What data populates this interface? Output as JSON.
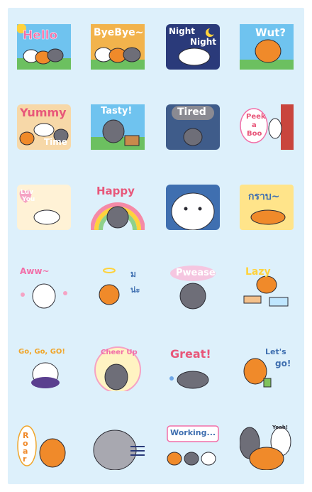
{
  "colors": {
    "panel": "#ddf0fb",
    "orange": "#f08a2a",
    "grey": "#6e6e78",
    "white": "#ffffff",
    "outline": "#2b2b33"
  },
  "stickers": [
    {
      "name": "hello",
      "text": "Hello"
    },
    {
      "name": "bye-bye",
      "text": "ByeBye~"
    },
    {
      "name": "night-night",
      "text": "Night",
      "text2": "Night"
    },
    {
      "name": "wut",
      "text": "Wut?"
    },
    {
      "name": "yummy-time",
      "text": "Yummy",
      "text2": "Time"
    },
    {
      "name": "tasty",
      "text": "Tasty!"
    },
    {
      "name": "tired",
      "text": "Tired"
    },
    {
      "name": "peek-a-boo",
      "text": "Peek",
      "text2": "a",
      "text3": "Boo"
    },
    {
      "name": "luv-you",
      "text": "Luv",
      "text2": "You"
    },
    {
      "name": "happy",
      "text": "Happy"
    },
    {
      "name": "white-tiger",
      "text": ""
    },
    {
      "name": "krab",
      "text": "กราบ~"
    },
    {
      "name": "aww",
      "text": "Aww~"
    },
    {
      "name": "thai-angel",
      "text": "ม",
      "text2": "น่ะ"
    },
    {
      "name": "please",
      "text": "Pwease"
    },
    {
      "name": "lazy",
      "text": "Lazy"
    },
    {
      "name": "go-go-go",
      "text": "Go, Go, GO!"
    },
    {
      "name": "cheer-up",
      "text": "Cheer Up"
    },
    {
      "name": "great",
      "text": "Great!"
    },
    {
      "name": "lets-go",
      "text": "Let's",
      "text2": "go!"
    },
    {
      "name": "roar",
      "text": "Roar"
    },
    {
      "name": "grey-tiger",
      "text": ""
    },
    {
      "name": "working",
      "text": "Working..."
    },
    {
      "name": "yeah",
      "text": "Yeah!"
    }
  ]
}
